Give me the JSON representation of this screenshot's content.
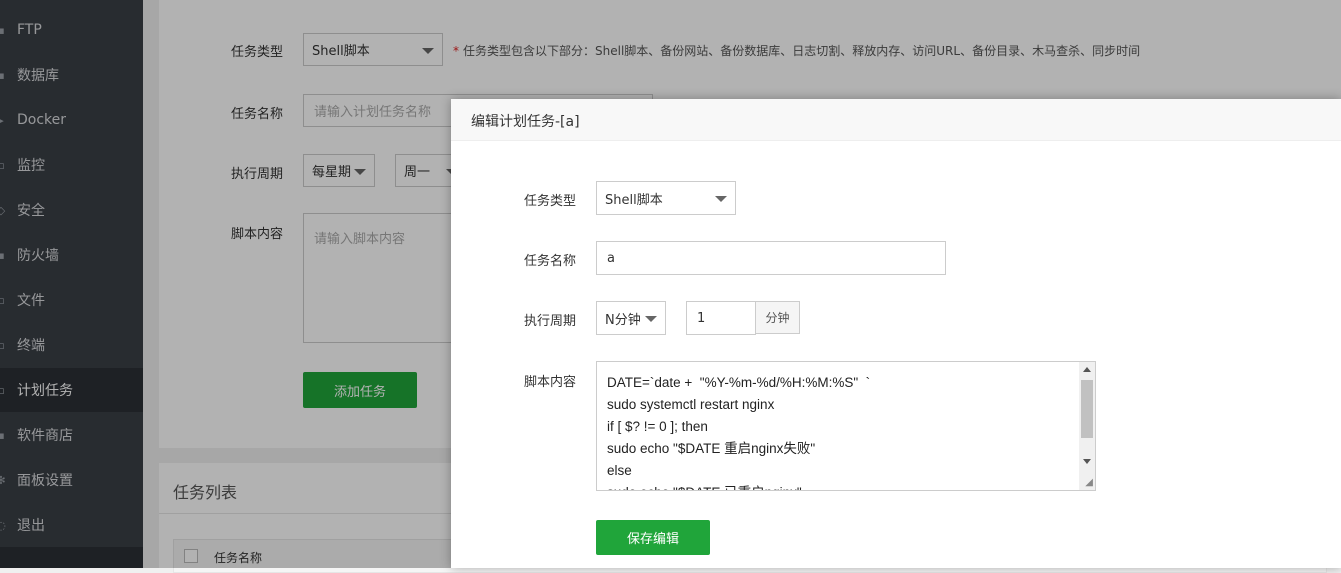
{
  "sidebar": {
    "items": [
      {
        "label": "FTP",
        "icon": "ftp-icon"
      },
      {
        "label": "数据库",
        "icon": "database-icon"
      },
      {
        "label": "Docker",
        "icon": "docker-icon"
      },
      {
        "label": "监控",
        "icon": "monitor-icon"
      },
      {
        "label": "安全",
        "icon": "shield-icon"
      },
      {
        "label": "防火墙",
        "icon": "firewall-icon"
      },
      {
        "label": "文件",
        "icon": "file-icon"
      },
      {
        "label": "终端",
        "icon": "terminal-icon"
      },
      {
        "label": "计划任务",
        "icon": "calendar-icon",
        "active": true
      },
      {
        "label": "软件商店",
        "icon": "store-icon"
      },
      {
        "label": "面板设置",
        "icon": "gear-icon"
      },
      {
        "label": "退出",
        "icon": "logout-icon"
      }
    ]
  },
  "form": {
    "task_type_label": "任务类型",
    "task_type_value": "Shell脚本",
    "task_type_hint_star": "*",
    "task_type_hint": "任务类型包含以下部分：Shell脚本、备份网站、备份数据库、日志切割、释放内存、访问URL、备份目录、木马查杀、同步时间",
    "task_name_label": "任务名称",
    "task_name_placeholder": "请输入计划任务名称",
    "period_label": "执行周期",
    "period_value": "每星期",
    "weekday_value": "周一",
    "script_label": "脚本内容",
    "script_placeholder": "请输入脚本内容",
    "add_button": "添加任务"
  },
  "task_list": {
    "title": "任务列表",
    "column_name": "任务名称"
  },
  "modal": {
    "title": "编辑计划任务-[a]",
    "task_type_label": "任务类型",
    "task_type_value": "Shell脚本",
    "task_name_label": "任务名称",
    "task_name_value": "a",
    "period_label": "执行周期",
    "period_value": "N分钟",
    "minutes_value": "1",
    "minutes_unit": "分钟",
    "script_label": "脚本内容",
    "script_lines": [
      "DATE=`date +  \"%Y-%m-%d/%H:%M:%S\"  `",
      "sudo systemctl restart nginx",
      "if [ $? != 0 ]; then",
      "sudo echo \"$DATE 重启nginx失败\"",
      "else",
      "sudo echo \"$DATE 已重启nginx\""
    ],
    "save_button": "保存编辑"
  },
  "colors": {
    "accent": "#20a53a",
    "sidebar_bg": "#3a3f46",
    "required_star": "#e02020"
  }
}
